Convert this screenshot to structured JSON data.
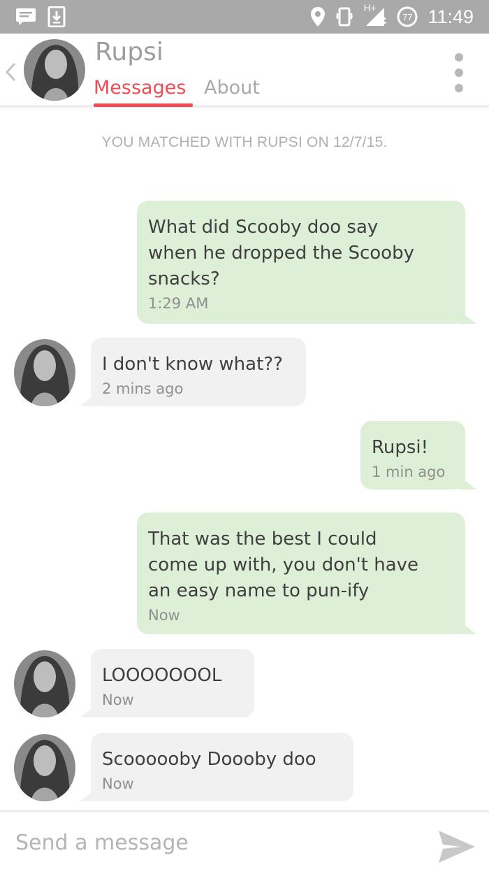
{
  "status_bar": {
    "time": "11:49",
    "network_label": "H+",
    "battery_level": "77",
    "left_icons": [
      "chat-notification-icon",
      "download-notification-icon"
    ],
    "right_icons": [
      "location-pin-icon",
      "vibrate-icon",
      "signal-icon",
      "battery-icon"
    ]
  },
  "header": {
    "match_name": "Rupsi",
    "tabs": [
      {
        "label": "Messages",
        "active": true
      },
      {
        "label": "About",
        "active": false
      }
    ],
    "accent_color": "#ef4d53"
  },
  "conversation": {
    "match_note": "YOU MATCHED WITH RUPSI ON 12/7/15.",
    "messages": [
      {
        "direction": "out",
        "text": "What did Scooby doo say\nwhen he dropped the Scooby\nsnacks?",
        "time": "1:29 AM"
      },
      {
        "direction": "in",
        "text": "I don't know what??",
        "time": "2 mins ago"
      },
      {
        "direction": "out",
        "text": "Rupsi!",
        "time": "1 min ago"
      },
      {
        "direction": "out",
        "text": "That was the best I could\ncome up with, you don't have\nan easy name to pun-ify",
        "time": "Now"
      },
      {
        "direction": "in",
        "text": "LOOOOOOOL",
        "time": "Now"
      },
      {
        "direction": "in",
        "text": "Scoooooby Doooby doo",
        "time": "Now"
      }
    ],
    "outgoing_bubble_color": "#ddf0d7",
    "incoming_bubble_color": "#f1f1f1"
  },
  "composer": {
    "placeholder": "Send a message",
    "value": "",
    "send_icon": "send-icon"
  }
}
